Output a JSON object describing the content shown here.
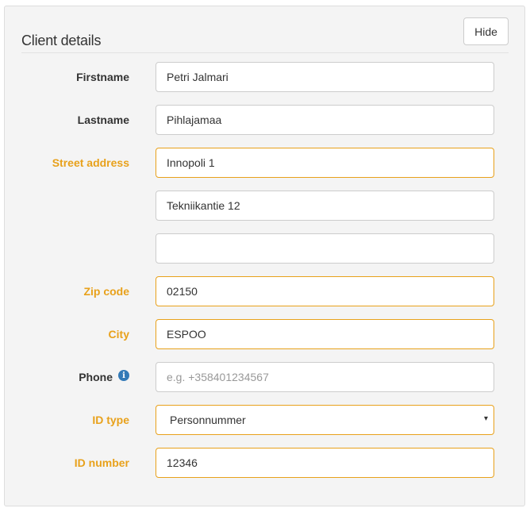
{
  "panel": {
    "title": "Client details",
    "hide_label": "Hide"
  },
  "fields": {
    "firstname": {
      "label": "Firstname",
      "value": "Petri Jalmari"
    },
    "lastname": {
      "label": "Lastname",
      "value": "Pihlajamaa"
    },
    "street": {
      "label": "Street address",
      "line1": "Innopoli 1",
      "line2": "Tekniikantie 12",
      "line3": ""
    },
    "zip": {
      "label": "Zip code",
      "value": "02150"
    },
    "city": {
      "label": "City",
      "value": "ESPOO"
    },
    "phone": {
      "label": "Phone",
      "value": "",
      "placeholder": "e.g. +358401234567",
      "info_icon": "i"
    },
    "id_type": {
      "label": "ID type",
      "value": "Personnummer",
      "caret": "▾"
    },
    "id_number": {
      "label": "ID number",
      "value": "12346"
    }
  },
  "colors": {
    "warning": "#e8a11b",
    "info": "#337ab7"
  },
  "icons": {
    "info": "info-icon",
    "dropdown": "chevron-down-icon"
  }
}
